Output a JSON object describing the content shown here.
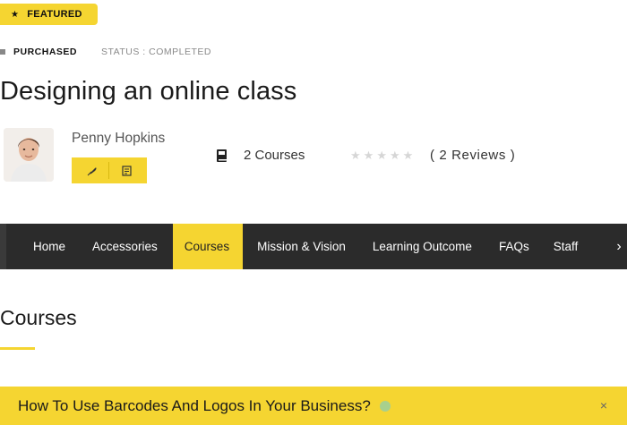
{
  "badge": {
    "label": "FEATURED"
  },
  "meta": {
    "purchased": "PURCHASED",
    "status": "STATUS : COMPLETED"
  },
  "course": {
    "title": "Designing an online class"
  },
  "instructor": {
    "name": "Penny Hopkins",
    "social_icons": [
      "feather-icon",
      "document-icon"
    ]
  },
  "stats": {
    "courses": "2 Courses",
    "rating": {
      "filled": 0,
      "max": 5
    },
    "reviews": "( 2 Reviews )"
  },
  "tabs": [
    {
      "label": "Home",
      "active": false
    },
    {
      "label": "Accessories",
      "active": false
    },
    {
      "label": "Courses",
      "active": true
    },
    {
      "label": "Mission & Vision",
      "active": false
    },
    {
      "label": "Learning Outcome",
      "active": false
    },
    {
      "label": "FAQs",
      "active": false
    },
    {
      "label": "Staff",
      "active": false
    }
  ],
  "section": {
    "title": "Courses"
  },
  "lesson": {
    "title": "How To Use Barcodes And Logos In Your Business?"
  },
  "colors": {
    "accent": "#f5d531",
    "nav_bg": "#2b2b2b"
  }
}
